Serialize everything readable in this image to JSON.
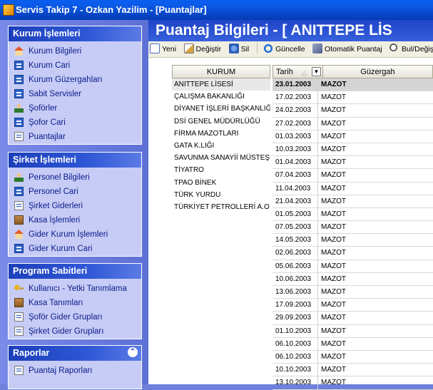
{
  "window": {
    "title": "Servis Takip 7 - Ozkan Yazilim - [Puantajlar]"
  },
  "sidebar": {
    "groups": [
      {
        "header": "Kurum İşlemleri",
        "items": [
          {
            "label": "Kurum Bilgileri",
            "icon": "house-icon"
          },
          {
            "label": "Kurum Cari",
            "icon": "table-icon"
          },
          {
            "label": "Kurum Güzergahları",
            "icon": "table-icon"
          },
          {
            "label": "Sabit Servisler",
            "icon": "table-icon"
          },
          {
            "label": "Şoförler",
            "icon": "person-icon"
          },
          {
            "label": "Şofor Cari",
            "icon": "table-icon"
          },
          {
            "label": "Puantajlar",
            "icon": "document-icon"
          }
        ]
      },
      {
        "header": "Şirket İşlemleri",
        "items": [
          {
            "label": "Personel Bilgileri",
            "icon": "person-icon"
          },
          {
            "label": "Personel Cari",
            "icon": "table-icon"
          },
          {
            "label": "Şirket Giderleri",
            "icon": "document-icon"
          },
          {
            "label": "Kasa İşlemleri",
            "icon": "box-icon"
          },
          {
            "label": "Gider Kurum İşlemleri",
            "icon": "house-icon"
          },
          {
            "label": "Gider Kurum Cari",
            "icon": "table-icon"
          }
        ]
      },
      {
        "header": "Program Sabitleri",
        "items": [
          {
            "label": "Kullanıcı - Yetki Tanımlama",
            "icon": "key-icon"
          },
          {
            "label": "Kasa Tanımları",
            "icon": "box-icon"
          },
          {
            "label": "Şoför Gider Grupları",
            "icon": "document-icon"
          },
          {
            "label": "Şirket Gider Grupları",
            "icon": "document-icon"
          }
        ]
      },
      {
        "header": "Raporlar",
        "items": [
          {
            "label": "Puantaj Raporları",
            "icon": "document-icon"
          }
        ]
      }
    ]
  },
  "main": {
    "title": "Puantaj Bilgileri - [ ANITTEPE LİS",
    "toolbar": {
      "new": "Yeni",
      "edit": "Değiştir",
      "delete": "Sil",
      "refresh": "Güncelle",
      "auto": "Otomatik Puantaj",
      "find": "Bul/Değişt"
    },
    "kurum_grid": {
      "header": "KURUM",
      "rows": [
        "ANITTEPE LİSESİ",
        "ÇALIŞMA BAKANLIĞI",
        "DİYANET İŞLERİ BAŞKANLIĞ",
        "DSİ GENEL MÜDÜRLÜĞÜ",
        "FİRMA MAZOTLARI",
        "GATA K.LIĞI",
        "SAVUNMA SANAYİİ MÜSTEŞ",
        "TİYATRO",
        "TPAO BİNEK",
        "TÜRK YURDU",
        "TÜRKİYET PETROLLERİ A.O"
      ]
    },
    "puantaj_grid": {
      "col_date": "Tarih",
      "col_route": "Güzergah",
      "rows": [
        {
          "date": "23.01.2003",
          "route": "MAZOT"
        },
        {
          "date": "17.02.2003",
          "route": "MAZOT"
        },
        {
          "date": "24.02.2003",
          "route": "MAZOT"
        },
        {
          "date": "27.02.2003",
          "route": "MAZOT"
        },
        {
          "date": "01.03.2003",
          "route": "MAZOT"
        },
        {
          "date": "10.03.2003",
          "route": "MAZOT"
        },
        {
          "date": "01.04.2003",
          "route": "MAZOT"
        },
        {
          "date": "07.04.2003",
          "route": "MAZOT"
        },
        {
          "date": "11.04.2003",
          "route": "MAZOT"
        },
        {
          "date": "21.04.2003",
          "route": "MAZOT"
        },
        {
          "date": "01.05.2003",
          "route": "MAZOT"
        },
        {
          "date": "07.05.2003",
          "route": "MAZOT"
        },
        {
          "date": "14.05.2003",
          "route": "MAZOT"
        },
        {
          "date": "02.06.2003",
          "route": "MAZOT"
        },
        {
          "date": "05.06.2003",
          "route": "MAZOT"
        },
        {
          "date": "10.06.2003",
          "route": "MAZOT"
        },
        {
          "date": "13.06.2003",
          "route": "MAZOT"
        },
        {
          "date": "17.09.2003",
          "route": "MAZOT"
        },
        {
          "date": "29.09.2003",
          "route": "MAZOT"
        },
        {
          "date": "01.10.2003",
          "route": "MAZOT"
        },
        {
          "date": "06.10.2003",
          "route": "MAZOT"
        },
        {
          "date": "06.10.2003",
          "route": "MAZOT"
        },
        {
          "date": "10.10.2003",
          "route": "MAZOT"
        },
        {
          "date": "13.10.2003",
          "route": "MAZOT"
        }
      ]
    }
  }
}
